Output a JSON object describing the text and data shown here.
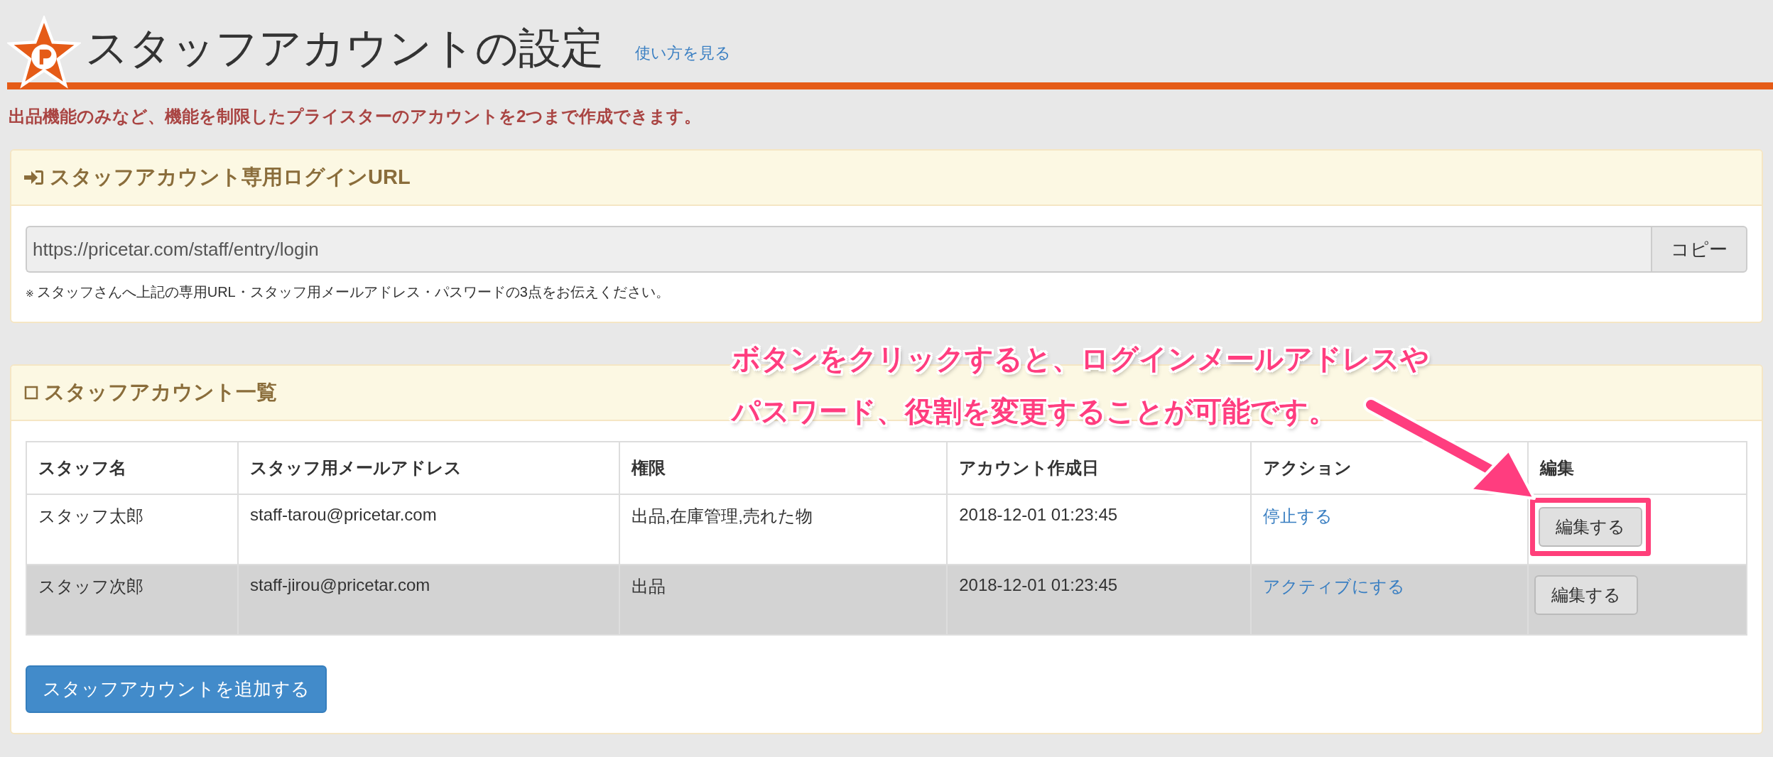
{
  "header": {
    "title": "スタッフアカウントの設定",
    "help_link": "使い方を見る"
  },
  "notice": "出品機能のみなど、機能を制限したプライスターのアカウントを2つまで作成できます。",
  "login_panel": {
    "title": "スタッフアカウント専用ログインURL",
    "url": "https://pricetar.com/staff/entry/login",
    "copy_button": "コピー",
    "note_mark": "※",
    "note": "スタッフさんへ上記の専用URL・スタッフ用メールアドレス・パスワードの3点をお伝えください。"
  },
  "list_panel": {
    "title": "スタッフアカウント一覧",
    "columns": [
      "スタッフ名",
      "スタッフ用メールアドレス",
      "権限",
      "アカウント作成日",
      "アクション",
      "編集"
    ],
    "rows": [
      {
        "name": "スタッフ太郎",
        "email": "staff-tarou@pricetar.com",
        "permissions": "出品,在庫管理,売れた物",
        "created": "2018-12-01 01:23:45",
        "action": "停止する",
        "edit": "編集する",
        "active": true,
        "highlighted": true
      },
      {
        "name": "スタッフ次郎",
        "email": "staff-jirou@pricetar.com",
        "permissions": "出品",
        "created": "2018-12-01 01:23:45",
        "action": "アクティブにする",
        "edit": "編集する",
        "active": false,
        "highlighted": false
      }
    ],
    "add_button": "スタッフアカウントを追加する"
  },
  "annotation": {
    "lines": [
      "ボタンをクリックすると、ログインメールアドレスや",
      "パスワード、役割を変更することが可能です。"
    ]
  }
}
